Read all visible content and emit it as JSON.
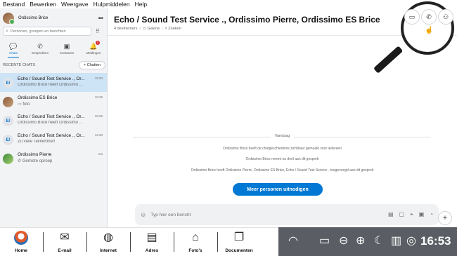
{
  "menubar": [
    "Bestand",
    "Bewerken",
    "Weergave",
    "Hulpmiddelen",
    "Help"
  ],
  "sidebar": {
    "profile_name": "Ordissimo Brice",
    "search_placeholder": "Personen, groepen en berichten",
    "tabs": [
      {
        "label": "Chats",
        "icon": "chat-icon"
      },
      {
        "label": "Gesprekken",
        "icon": "phone-icon"
      },
      {
        "label": "Contacten",
        "icon": "contacts-icon"
      },
      {
        "label": "Meldingen",
        "icon": "bell-icon",
        "badge": "1"
      }
    ],
    "recent_label": "RECENTE CHATS",
    "new_chat_label": "+ Chatten",
    "chats": [
      {
        "title": "Echo / Sound Test Service ., Or...",
        "sub": "Ordissimo Brice heeft Ordissimo ...",
        "time": "16:53",
        "avatar": "E/"
      },
      {
        "title": "Ordissimo ES Brice",
        "sub": "foto",
        "time": "16:29",
        "avatar": ""
      },
      {
        "title": "Echo / Sound Test Service ., Or...",
        "sub": "Ordissimo Brice heeft Ordissimo ...",
        "time": "16:06",
        "avatar": "E/"
      },
      {
        "title": "Echo / Sound Test Service ., Or...",
        "sub": "Zu viele Teilnehmer!",
        "time": "12:30",
        "avatar": "E/"
      },
      {
        "title": "Ordissimo Pierre",
        "sub": "Gemiste oproep",
        "time": "ma",
        "avatar": ""
      }
    ]
  },
  "main": {
    "title": "Echo / Sound Test Service ., Ordissimo Pierre, Ordissimo ES Brice",
    "participants": "4 deelnemers",
    "gallery": "Galerie",
    "find": "Zoeken",
    "date_label": "Vandaag",
    "messages": [
      "Ordissimo Brice heeft de chatgeschiedenis zichtbaar gemaakt voor iedereen",
      "Ordissimo Brice neemt nu deel aan dit gesprek",
      "Ordissimo Brice heeft Ordissimo Pierre, Ordissimo ES Brice, Echo / Sound Test Service . toegevoegd aan dit gesprek"
    ],
    "invite_label": "Meer personen uitnodigen",
    "compose_placeholder": "Typ hier een bericht"
  },
  "taskbar": {
    "items": [
      "Home",
      "E-mail",
      "Internet",
      "Adres",
      "Foto's",
      "Documenten"
    ],
    "clock": "16:53"
  }
}
